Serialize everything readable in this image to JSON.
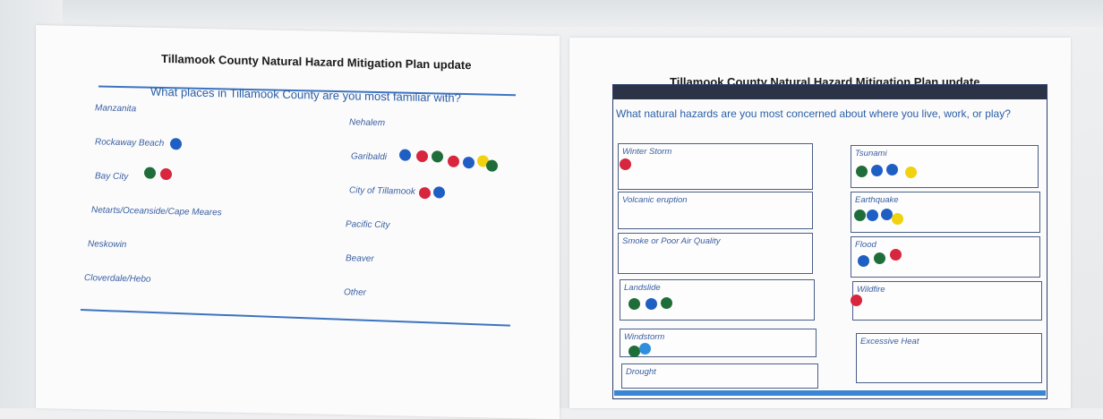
{
  "left_poster": {
    "title": "Tillamook County Natural Hazard Mitigation Plan update",
    "question": "What places in Tillamook County are you most familiar with?",
    "places": [
      {
        "label": "Manzanita",
        "dots": []
      },
      {
        "label": "Rockaway Beach",
        "dots": [
          "blue"
        ]
      },
      {
        "label": "Bay City",
        "dots": [
          "green",
          "red"
        ]
      },
      {
        "label": "Netarts/Oceanside/Cape Meares",
        "dots": []
      },
      {
        "label": "Neskowin",
        "dots": []
      },
      {
        "label": "Cloverdale/Hebo",
        "dots": []
      },
      {
        "label": "Nehalem",
        "dots": []
      },
      {
        "label": "Garibaldi",
        "dots": [
          "blue",
          "red",
          "green",
          "red",
          "blue",
          "yellow",
          "green"
        ]
      },
      {
        "label": "City of Tillamook",
        "dots": [
          "red",
          "blue"
        ]
      },
      {
        "label": "Pacific City",
        "dots": []
      },
      {
        "label": "Beaver",
        "dots": []
      },
      {
        "label": "Other",
        "dots": []
      }
    ]
  },
  "right_poster": {
    "title": "Tillamook County Natural Hazard Mitigation Plan update",
    "question": "What natural hazards are you most concerned about where you live, work, or play?",
    "hazards": [
      {
        "label": "Winter Storm",
        "dots": [
          "red"
        ]
      },
      {
        "label": "Volcanic eruption",
        "dots": []
      },
      {
        "label": "Smoke or Poor Air Quality",
        "dots": []
      },
      {
        "label": "Landslide",
        "dots": [
          "green",
          "blue",
          "green"
        ]
      },
      {
        "label": "Windstorm",
        "dots": [
          "green",
          "lightblue"
        ]
      },
      {
        "label": "Drought",
        "dots": []
      },
      {
        "label": "Tsunami",
        "dots": [
          "green",
          "blue",
          "blue",
          "yellow"
        ]
      },
      {
        "label": "Earthquake",
        "dots": [
          "green",
          "blue",
          "blue",
          "yellow"
        ]
      },
      {
        "label": "Flood",
        "dots": [
          "blue",
          "green",
          "red"
        ]
      },
      {
        "label": "Wildfire",
        "dots": [
          "red"
        ]
      },
      {
        "label": "Excessive Heat",
        "dots": []
      }
    ]
  },
  "colors": {
    "blue": "#1f5fc4",
    "red": "#d7263d",
    "green": "#1f6e3a",
    "yellow": "#f0d20e",
    "lightblue": "#2f8fdb",
    "text_blue": "#2b5fa6"
  }
}
